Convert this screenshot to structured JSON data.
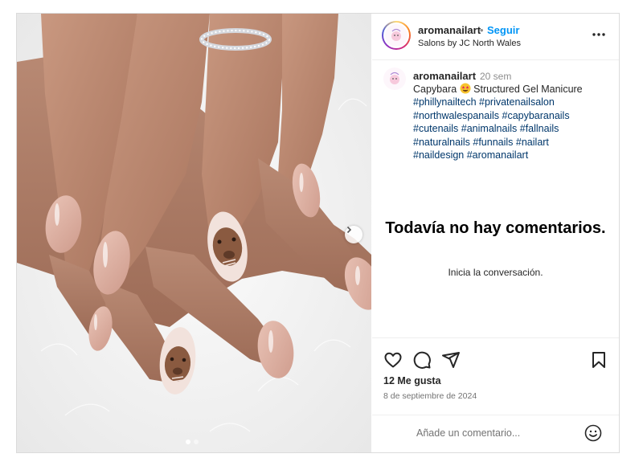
{
  "post": {
    "image_alt": "Manos con manicura de gel color nude y uñas decoradas con capibaras",
    "carousel": {
      "total": 2,
      "current": 1
    }
  },
  "header": {
    "username": "aromanailart",
    "separator": "•",
    "follow_label": "Seguir",
    "location": "Salons by JC North Wales"
  },
  "caption": {
    "username": "aromanailart",
    "time": "20 sem",
    "text_before_emoji": "Capybara ",
    "text_after_emoji": " Structured Gel Manicure",
    "hashtag_lines": [
      [
        "#phillynailtech",
        "#privatenailsalon"
      ],
      [
        "#northwalespanails",
        "#capybaranails"
      ],
      [
        "#cutenails",
        "#animalnails",
        "#fallnails"
      ],
      [
        "#naturalnails",
        "#funnails",
        "#nailart"
      ],
      [
        "#naildesign",
        "#aromanailart"
      ]
    ]
  },
  "comments": {
    "empty_title": "Todavía no hay comentarios.",
    "empty_subtitle": "Inicia la conversación."
  },
  "footer": {
    "likes": "12 Me gusta",
    "date": "8 de septiembre de 2024",
    "comment_placeholder": "Añade un comentario..."
  },
  "icons": {
    "like": "heart-icon",
    "comment": "comment-bubble-icon",
    "share": "paper-plane-icon",
    "save": "bookmark-icon",
    "more": "more-horizontal-icon",
    "emoji": "emoji-smile-icon",
    "next": "chevron-right-icon"
  },
  "colors": {
    "accent": "#0095f6",
    "hashtag": "#00376b",
    "nail_polish": "#d9a99a",
    "fur_background": "#f4f4f4"
  }
}
